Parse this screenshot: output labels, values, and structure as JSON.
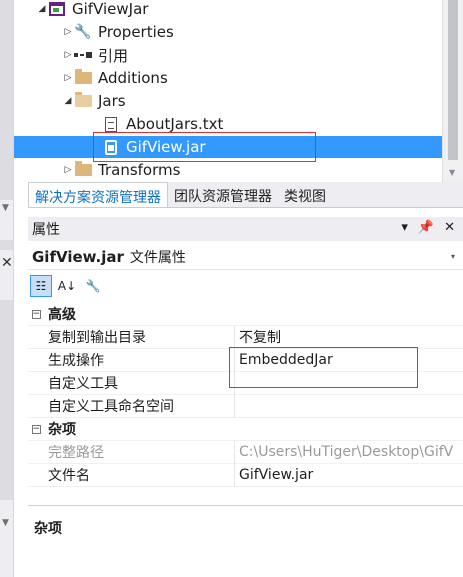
{
  "solution_explorer": {
    "items": [
      {
        "label": "GifViewJar",
        "icon": "project-icon",
        "expander": "▲"
      },
      {
        "label": "Properties",
        "icon": "wrench-icon",
        "expander": "▷"
      },
      {
        "label": "引用",
        "icon": "references-icon",
        "expander": "▷"
      },
      {
        "label": "Additions",
        "icon": "folder-icon",
        "expander": "▷"
      },
      {
        "label": "Jars",
        "icon": "folder-open-icon",
        "expander": "◢"
      },
      {
        "label": "AboutJars.txt",
        "icon": "text-file-icon",
        "expander": ""
      },
      {
        "label": "GifView.jar",
        "icon": "jar-file-icon",
        "expander": ""
      },
      {
        "label": "Transforms",
        "icon": "folder-icon",
        "expander": "▷"
      }
    ],
    "selected_index": 6,
    "accent": "#3399ff"
  },
  "tabs": [
    {
      "label": "解决方案资源管理器",
      "active": true
    },
    {
      "label": "团队资源管理器",
      "active": false
    },
    {
      "label": "类视图",
      "active": false
    }
  ],
  "properties": {
    "title": "属性",
    "header_buttons": {
      "dropdown": "▾",
      "pin": "ᛘ",
      "close": "✕"
    },
    "object_name": "GifView.jar",
    "object_kind": "文件属性",
    "object_dropdown": "▾",
    "toolbar": {
      "categorized_icon": "categorized-icon",
      "alphabetical_icon": "alphabetical-icon",
      "property_pages_icon": "wrench-icon"
    },
    "categories": [
      {
        "name": "高级",
        "collapse": "⊟",
        "rows": [
          {
            "name": "复制到输出目录",
            "value": "不复制",
            "dim": false
          },
          {
            "name": "生成操作",
            "value": "EmbeddedJar",
            "dim": false
          },
          {
            "name": "自定义工具",
            "value": "",
            "dim": false
          },
          {
            "name": "自定义工具命名空间",
            "value": "",
            "dim": false
          }
        ]
      },
      {
        "name": "杂项",
        "collapse": "⊟",
        "rows": [
          {
            "name": "完整路径",
            "value": "C:\\Users\\HuTiger\\Desktop\\GifV",
            "dim": true
          },
          {
            "name": "文件名",
            "value": "GifView.jar",
            "dim": false
          }
        ]
      }
    ],
    "description_title": "杂项"
  }
}
